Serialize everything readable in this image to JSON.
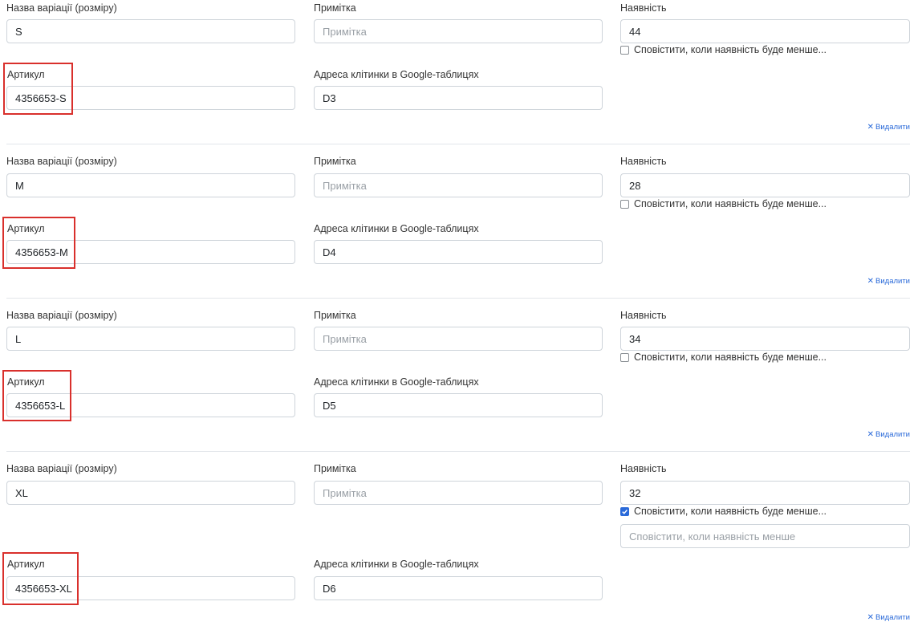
{
  "labels": {
    "variation_name": "Назва варіації (розміру)",
    "note": "Примітка",
    "availability": "Наявність",
    "sku": "Артикул",
    "cell_address": "Адреса клітинки в Google-таблицях",
    "notify": "Сповістити, коли наявність буде менше...",
    "remove": "Видалити"
  },
  "placeholders": {
    "note": "Примітка",
    "notify_threshold": "Сповістити, коли наявність менше"
  },
  "variations": [
    {
      "name": "S",
      "note": "",
      "stock": "44",
      "sku": "4356653-S",
      "cell": "D3",
      "notify_checked": false
    },
    {
      "name": "M",
      "note": "",
      "stock": "28",
      "sku": "4356653-M",
      "cell": "D4",
      "notify_checked": false
    },
    {
      "name": "L",
      "note": "",
      "stock": "34",
      "sku": "4356653-L",
      "cell": "D5",
      "notify_checked": false
    },
    {
      "name": "XL",
      "note": "",
      "stock": "32",
      "sku": "4356653-XL",
      "cell": "D6",
      "notify_checked": true
    }
  ],
  "colors": {
    "accent": "#2a6ad9",
    "highlight": "#d9302c",
    "border": "#ced4da"
  }
}
